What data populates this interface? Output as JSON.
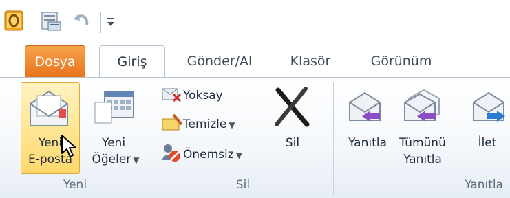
{
  "qat": {
    "icons": [
      "outlook-icon",
      "send-receive-icon",
      "undo-icon",
      "customize-qat-icon"
    ]
  },
  "tabs": [
    {
      "label": "Dosya"
    },
    {
      "label": "Giriş"
    },
    {
      "label": "Gönder/Al"
    },
    {
      "label": "Klasör"
    },
    {
      "label": "Görünüm"
    }
  ],
  "groups": {
    "yeni": {
      "label": "Yeni",
      "new_email": {
        "line1": "Yeni",
        "line2": "E-posta",
        "icon": "new-email-icon"
      },
      "new_items": {
        "line1": "Yeni",
        "line2": "Öğeler",
        "icon": "new-items-icon"
      }
    },
    "sil": {
      "label": "Sil",
      "ignore": "Yoksay",
      "cleanup": "Temizle",
      "junk": "Önemsiz",
      "delete": "Sil"
    },
    "yanitla": {
      "label": "Yanıtla",
      "reply": "Yanıtla",
      "reply_all_1": "Tümünü",
      "reply_all_2": "Yanıtla",
      "forward": "İlet"
    }
  },
  "colors": {
    "file_tab": "#e8731f",
    "highlight": "#ffd86b",
    "text": "#1e2c3c"
  }
}
